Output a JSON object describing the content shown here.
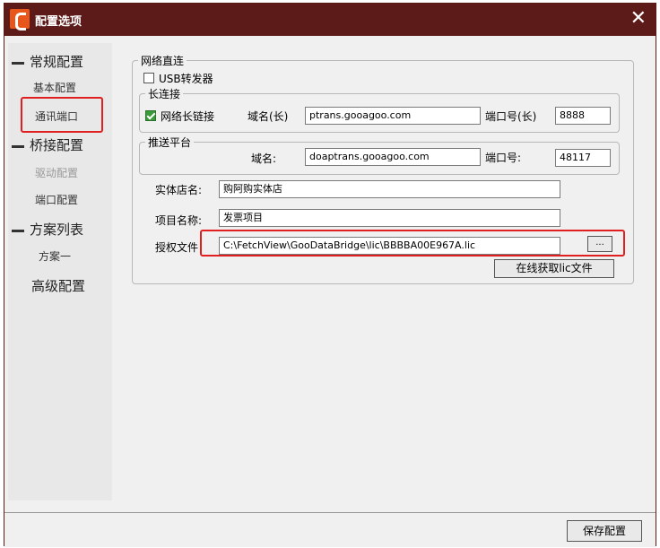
{
  "window": {
    "title": "配置选项",
    "close_glyph": "✕"
  },
  "sidebar": {
    "group_general": "常规配置",
    "item_basic": "基本配置",
    "item_comm": "通讯端口",
    "group_bridge": "桥接配置",
    "item_driver": "驱动配置",
    "item_port": "端口配置",
    "group_scheme": "方案列表",
    "item_scheme1": "方案一",
    "advanced": "高级配置"
  },
  "network": {
    "legend": "网络直连",
    "usb_forwarder_label": "USB转发器",
    "usb_forwarder_checked": false,
    "long_conn": {
      "legend": "长连接",
      "enable_label": "网络长链接",
      "enable_checked": true,
      "domain_label": "域名(长)",
      "domain_value": "ptrans.gooagoo.com",
      "port_label": "端口号(长)",
      "port_value": "8888"
    },
    "push": {
      "legend": "推送平台",
      "domain_label": "域名:",
      "domain_value": "doaptrans.gooagoo.com",
      "port_label": "端口号:",
      "port_value": "48117"
    },
    "store_name_label": "实体店名:",
    "store_name_value": "购阿购实体店",
    "project_name_label": "项目名称:",
    "project_name_value": "发票项目",
    "license_label": "授权文件",
    "license_value": "C:\\FetchView\\GooDataBridge\\lic\\BBBBA00E967A.lic",
    "browse_label": "...",
    "online_get_label": "在线获取lic文件"
  },
  "footer": {
    "save_label": "保存配置"
  },
  "colors": {
    "titlebar": "#5c1a18",
    "highlight": "#e02020",
    "check": "#3a9b3a"
  }
}
